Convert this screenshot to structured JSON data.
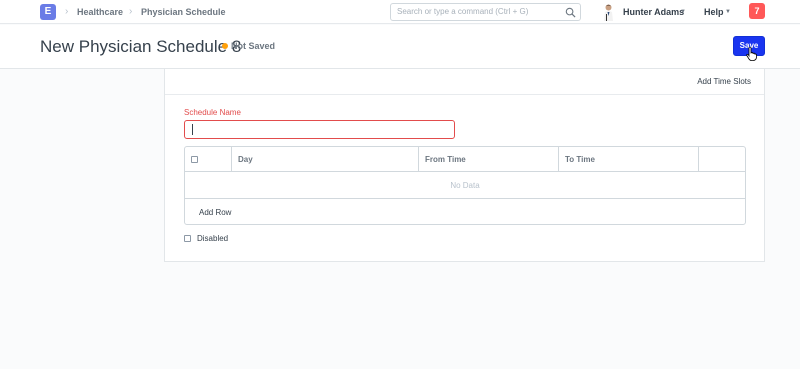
{
  "navbar": {
    "logo_letter": "E",
    "breadcrumbs": [
      "Healthcare",
      "Physician Schedule"
    ],
    "search_placeholder": "Search or type a command (Ctrl + G)",
    "user_name": "Hunter Adams",
    "help_label": "Help",
    "notification_count": "7"
  },
  "page_head": {
    "title": "New Physician Schedule 8",
    "status": "Not Saved",
    "save_label": "Save"
  },
  "form": {
    "toolbar_action": "Add Time Slots",
    "schedule_name_label": "Schedule Name",
    "schedule_name_value": "",
    "grid": {
      "columns": [
        "Day",
        "From Time",
        "To Time"
      ],
      "empty_text": "No Data",
      "add_row_label": "Add Row"
    },
    "disabled_label": "Disabled"
  },
  "colors": {
    "primary": "#1a35f0",
    "required": "#e24c4c",
    "status_dot": "#ffa00a",
    "notification": "#ff5858",
    "logo": "#6a7ce6"
  }
}
